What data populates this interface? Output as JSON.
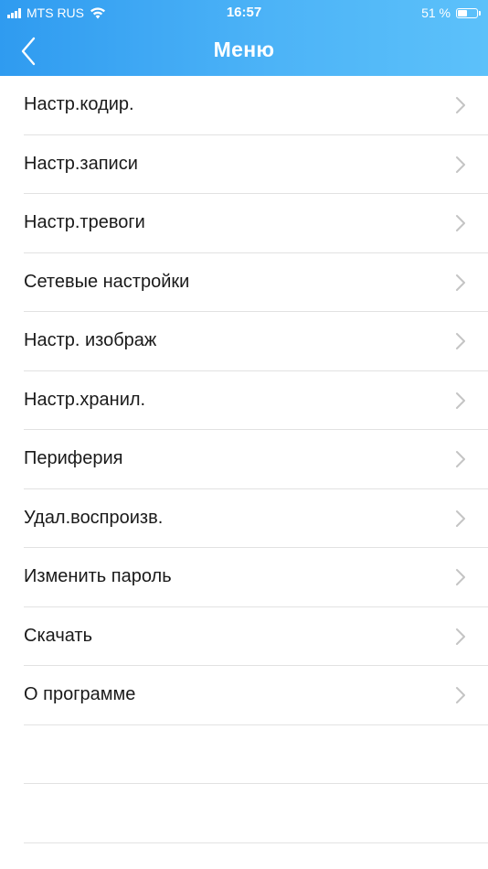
{
  "status_bar": {
    "carrier": "MTS RUS",
    "time": "16:57",
    "battery_text": "51 %",
    "battery_level": 0.51,
    "signal_icon": "cellular-signal-icon",
    "wifi_icon": "wifi-icon",
    "battery_icon": "battery-icon"
  },
  "nav": {
    "title": "Меню",
    "back_icon": "chevron-left-icon"
  },
  "menu": {
    "items": [
      {
        "label": "Настр.кодир."
      },
      {
        "label": "Настр.записи"
      },
      {
        "label": "Настр.тревоги"
      },
      {
        "label": "Сетевые настройки"
      },
      {
        "label": "Настр. изображ"
      },
      {
        "label": "Настр.хранил."
      },
      {
        "label": "Периферия"
      },
      {
        "label": "Удал.воспроизв."
      },
      {
        "label": "Изменить пароль"
      },
      {
        "label": "Скачать"
      },
      {
        "label": "О программе"
      }
    ],
    "item_icon": "chevron-right-icon"
  },
  "colors": {
    "header_start": "#2f9bf0",
    "header_end": "#5cc1fa",
    "separator": "#e2e2e2",
    "chevron": "#c4c4c4",
    "text": "#1a1a1a"
  }
}
